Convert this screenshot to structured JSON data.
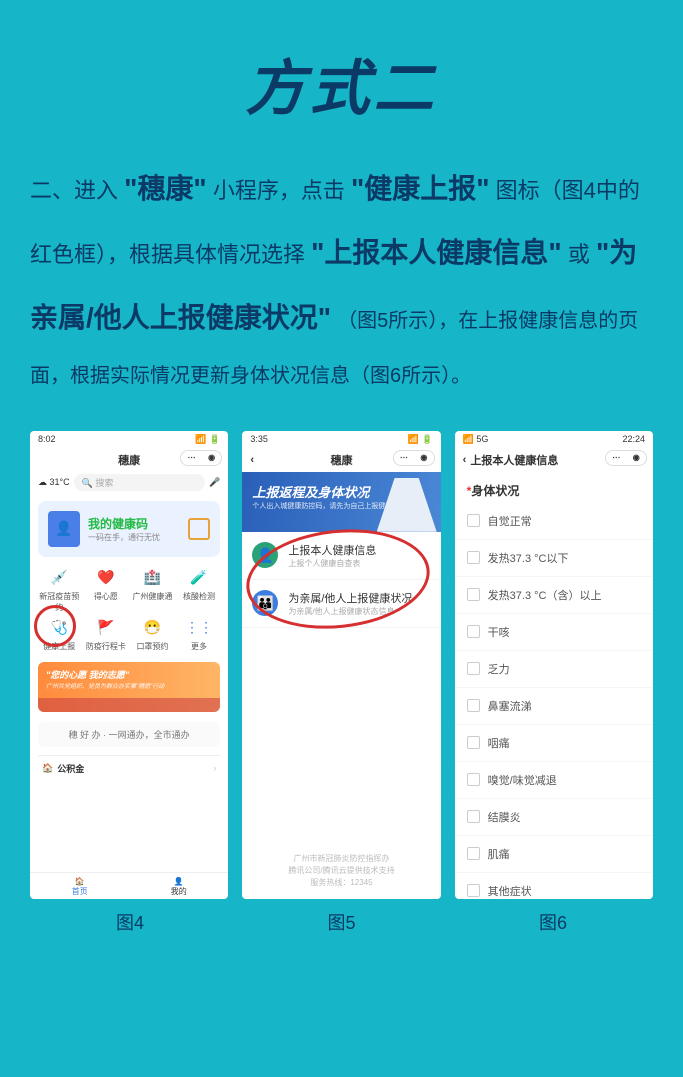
{
  "title": "方式二",
  "intro": {
    "p1a": "二、进入",
    "k1": "\"穗康\"",
    "p1b": "小程序，点击",
    "k2": "\"健康上报\"",
    "p1c": "图标（图4中的红色框），根据具体情况选择",
    "k3": "\"上报本人健康信息\"",
    "p1d": "或",
    "k4": "\"为亲属/他人上报健康状况\"",
    "p1e": "（图5所示），在上报健康信息的页面，根据实际情况更新身体状况信息（图6所示）。"
  },
  "captions": {
    "c1": "图4",
    "c2": "图5",
    "c3": "图6"
  },
  "phone1": {
    "time": "8:02",
    "app": "穗康",
    "temp": "31°C",
    "search": "搜索",
    "hcode_title": "我的健康码",
    "hcode_sub": "一码在手，通行无忧",
    "grid": [
      "新冠疫苗预约",
      "得心愿",
      "广州健康通",
      "核酸检测",
      "健康上报",
      "防疫行程卡",
      "口罩预约",
      "更多"
    ],
    "banner_l1": "\"您的心愿 我的志愿\"",
    "banner_l2": "广州共党组织、党员为群众办实事\"穗愿\"行动",
    "voice": "穗 好 办  ·  一网通办，全市通办",
    "fund": "公积金",
    "tab1": "首页",
    "tab2": "我的"
  },
  "phone2": {
    "time": "3:35",
    "app": "穗康",
    "hero_t": "上报返程及身体状况",
    "hero_s": "个人出入城健康防控码，请先为自己上报健康情况",
    "opt1_t": "上报本人健康信息",
    "opt1_s": "上报个人健康自查表",
    "opt2_t": "为亲属/他人上报健康状况",
    "opt2_s": "为亲属/他人上报健康状态信息",
    "foot1": "广州市新冠肺炎防控指挥办",
    "foot2": "腾讯公司/腾讯云提供技术支持",
    "foot3": "服务热线：12345"
  },
  "phone3": {
    "time": "22:24",
    "title": "上报本人健康信息",
    "section": "身体状况",
    "items": [
      "自觉正常",
      "发热37.3 °C以下",
      "发热37.3 °C（含）以上",
      "干咳",
      "乏力",
      "鼻塞流涕",
      "咽痛",
      "嗅觉/味觉减退",
      "结膜炎",
      "肌痛",
      "其他症状"
    ]
  }
}
